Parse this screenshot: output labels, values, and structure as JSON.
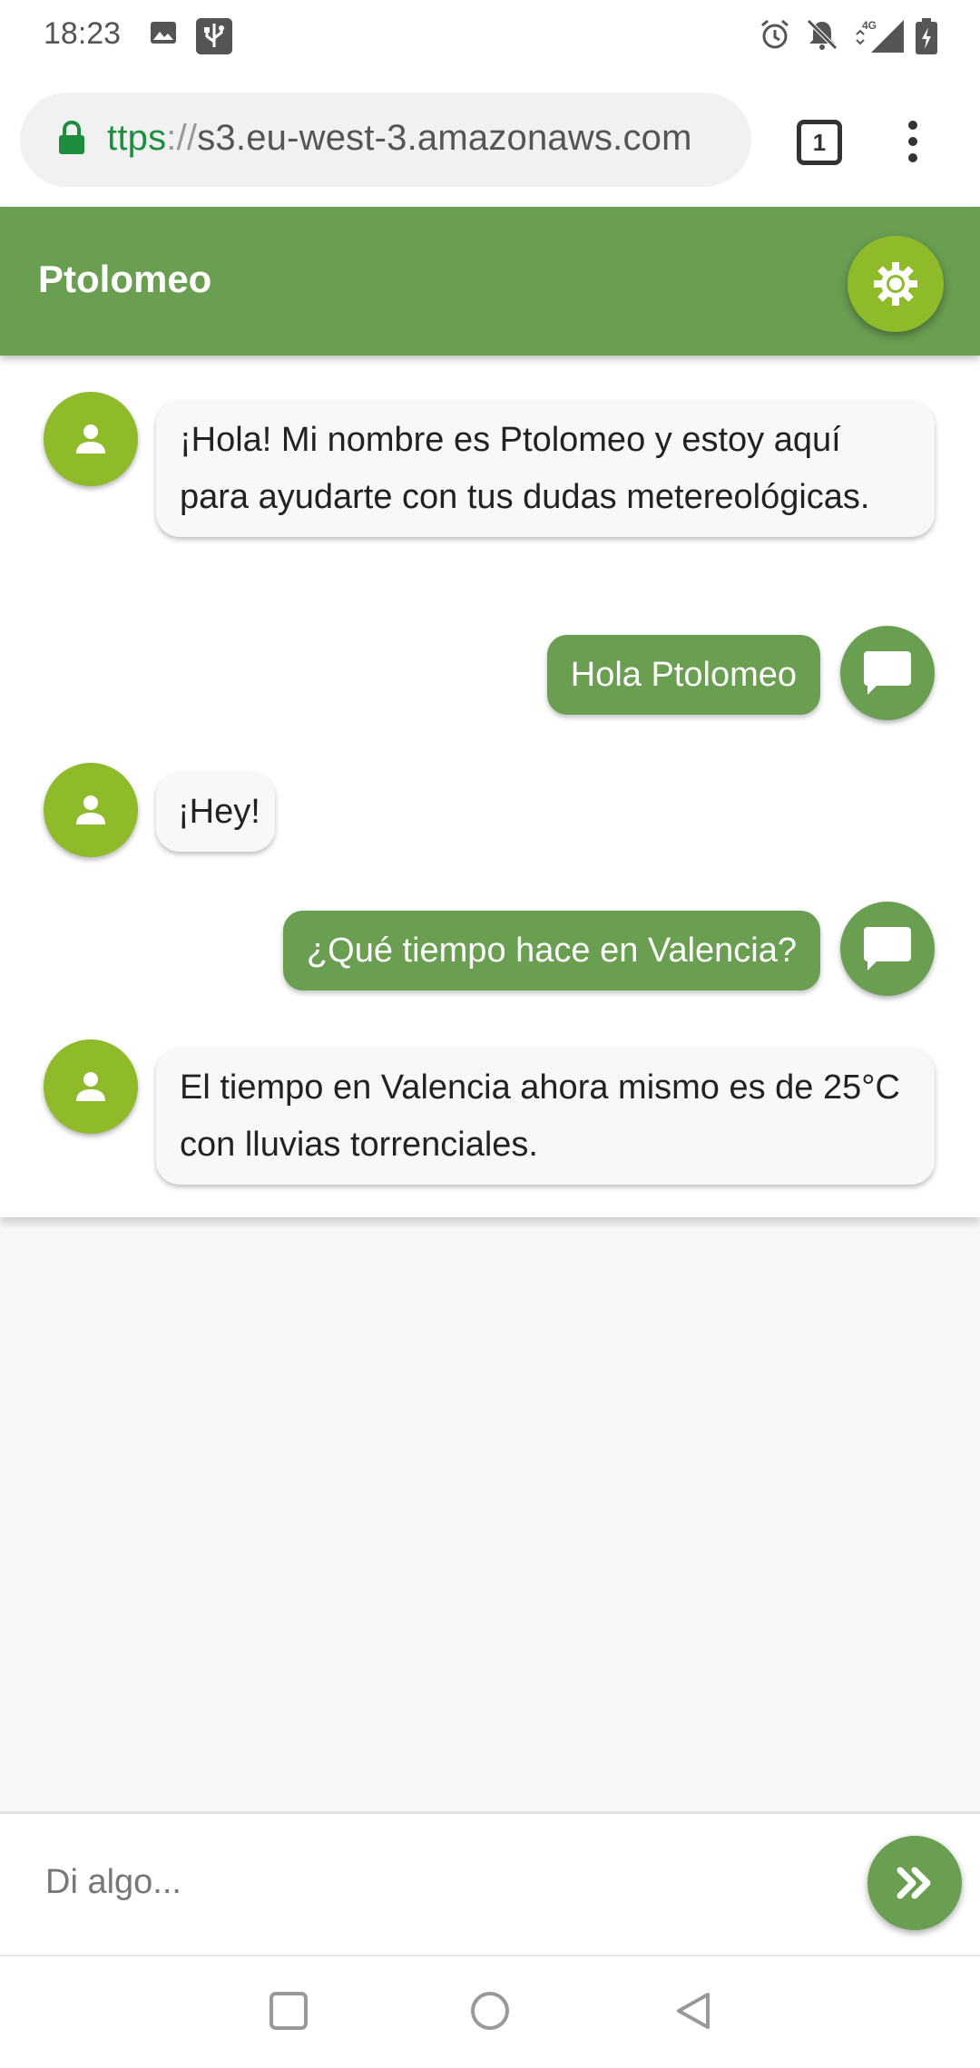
{
  "status_bar": {
    "time": "18:23",
    "network": "4G"
  },
  "browser": {
    "url_scheme": "ttps",
    "url_separator": "://",
    "url_host": "s3.eu-west-3.amazonaws.com",
    "tab_count": "1"
  },
  "app": {
    "title": "Ptolomeo"
  },
  "messages": [
    {
      "sender": "bot",
      "text": "¡Hola! Mi nombre es Ptolomeo y estoy aquí para ayudarte con tus dudas metereológicas."
    },
    {
      "sender": "user",
      "text": "Hola Ptolomeo"
    },
    {
      "sender": "bot",
      "text": "¡Hey!"
    },
    {
      "sender": "user",
      "text": "¿Qué tiempo hace en Valencia?"
    },
    {
      "sender": "bot",
      "text": "El tiempo en Valencia ahora mismo es de 25°C con lluvias torrenciales."
    }
  ],
  "input": {
    "placeholder": "Di algo..."
  },
  "colors": {
    "header": "#6a9f52",
    "accent": "#8fbb2b",
    "url_scheme": "#1e8e3e"
  }
}
